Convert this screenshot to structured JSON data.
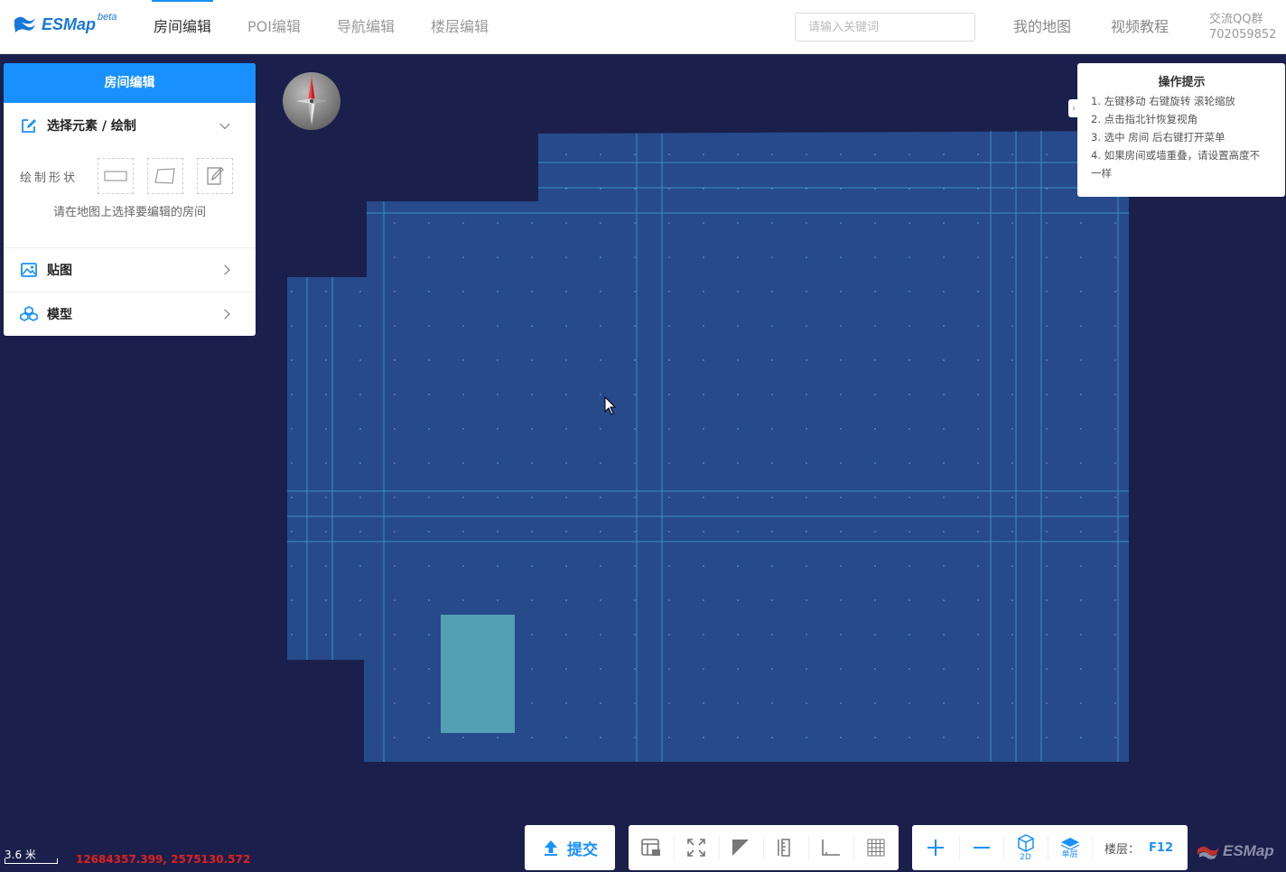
{
  "header": {
    "logo_text": "ESMap",
    "logo_sup": "beta",
    "tabs": [
      {
        "label": "房间编辑"
      },
      {
        "label": "POI编辑"
      },
      {
        "label": "导航编辑"
      },
      {
        "label": "楼层编辑"
      }
    ],
    "search_placeholder": "请输入关键词",
    "my_map": "我的地图",
    "video_tutorial": "视频教程",
    "qq_label": "交流QQ群",
    "qq_number": "702059852"
  },
  "panel": {
    "title": "房间编辑",
    "sections": [
      {
        "label": "选择元素 / 绘制",
        "icon": "edit-icon",
        "expanded": true
      },
      {
        "label": "贴图",
        "icon": "image-icon",
        "expanded": false
      },
      {
        "label": "模型",
        "icon": "cubes-icon",
        "expanded": false
      }
    ],
    "shape_label": "绘制形状",
    "hint": "请在地图上选择要编辑的房间"
  },
  "tips": {
    "title": "操作提示",
    "lines": [
      "1. 左键移动 右键旋转 滚轮缩放",
      "2. 点击指北针恢复视角",
      "3. 选中 房间 后右键打开菜单",
      "4. 如果房间或墙重叠，请设置高度不",
      "一样"
    ]
  },
  "footer": {
    "scale": "3.6 米",
    "coords": "12684357.399, 2575130.572",
    "submit": "提交",
    "tool_icons": [
      "layout-icon",
      "fullscreen-icon",
      "corner-icon",
      "ruler-icon",
      "angle-icon",
      "grid-icon"
    ],
    "view_2d": "2D",
    "view_single": "单层",
    "floor_label": "楼层：",
    "floor_value": "F12",
    "brand": "ESMap"
  },
  "colors": {
    "accent": "#1890ff",
    "map_background": "#1b1f4b",
    "floor_fill": "#264a8a",
    "room_fill": "#53a0b4",
    "grid_line": "#3fa8d8",
    "coords_text": "#e0201d"
  }
}
